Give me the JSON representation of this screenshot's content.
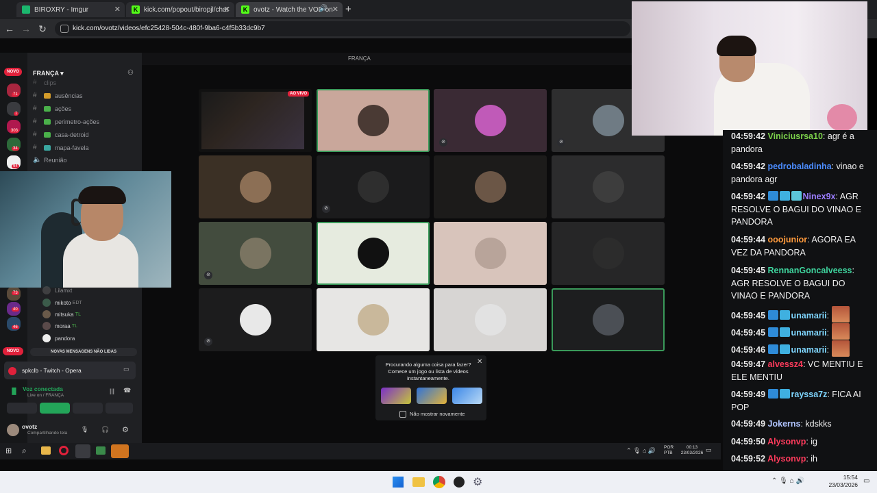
{
  "browser": {
    "tabs": [
      {
        "label": "BIROXRY - Imgur",
        "color": "#1bb76e"
      },
      {
        "label": "kick.com/popout/biropjl/chat",
        "color": "#53fc18"
      },
      {
        "label": "ovotz - Watch the VOD on",
        "color": "#53fc18"
      }
    ],
    "new_tab": "+",
    "url": "kick.com/ovotz/videos/efc25428-504c-480f-9ba6-c4f5b33dc9b7",
    "icons": [
      "back-icon",
      "forward-icon",
      "reload-icon",
      "site-info-icon",
      "close-icon",
      "speaker-icon",
      "plus-icon"
    ]
  },
  "discord": {
    "server_name": "FRANÇA",
    "top_title": "FRANÇA",
    "novo_badge": "NOVO",
    "novo_badge_bottom": "NOVO",
    "server_counts": [
      "71",
      "1",
      "303",
      "34",
      "94",
      "73",
      "40",
      "46"
    ],
    "channels": [
      "clips",
      "ausências",
      "ações",
      "perimetro-ações",
      "casa-detroid",
      "mapa-favela",
      "Reunião"
    ],
    "voice_members": [
      {
        "name": "Lilamxt",
        "tag": ""
      },
      {
        "name": "mikoto",
        "tag": "EDT"
      },
      {
        "name": "mitsuka",
        "tag": "TL"
      },
      {
        "name": "moraa",
        "tag": "TL"
      },
      {
        "name": "pandora",
        "tag": ""
      }
    ],
    "unread_banner": "NOVAS MENSAGENS NÃO LIDAS",
    "activity": "spkclb - Twitch - Opera",
    "voice_status": "Voz conectada",
    "voice_channel": "Live on / FRANÇA",
    "user_name": "ovotz",
    "user_status": "Compartilhando tela"
  },
  "grid": {
    "live_label": "AO VIVO",
    "tile_colors": [
      "#111111",
      "#c9a79b",
      "#3a2a34",
      "#2e2e2f",
      "#3b3025",
      "#1b1b1c",
      "#1c1b1a",
      "#2c2c2d",
      "#434c3e",
      "#e6ebdf",
      "#d8c4bb",
      "#262627",
      "#1c1c1d",
      "#e7e6e4",
      "#d7d5d3",
      "#1d1e1f"
    ],
    "avatar_colors": [
      "#333333",
      "#4a3a34",
      "#c05ab8",
      "#6f7b84",
      "#8c6f55",
      "#2e2e2e",
      "#6b5646",
      "#3d3d3d",
      "#7a7461",
      "#111111",
      "#b8a49a",
      "#2c2c2c",
      "#e8e8e8",
      "#c9b89b",
      "#e2e2e2",
      "#4b4f55"
    ],
    "active_tiles": [
      1,
      9,
      15
    ]
  },
  "popup": {
    "title": "Procurando alguma coisa para fazer? Comece um jogo ou lista de vídeos instantaneamente.",
    "checkbox_label": "Não mostrar novamente"
  },
  "inner_taskbar": {
    "lang": "POR",
    "lang2": "PTB",
    "time": "00:13",
    "date": "23/03/2026"
  },
  "chat": {
    "messages": [
      {
        "time": "04:59:42",
        "user": "Viniciusrsa10",
        "color": "#7cd14b",
        "badges": 0,
        "text": ": agr é a pandora"
      },
      {
        "time": "04:59:42",
        "user": "pedrobaladinha",
        "color": "#4b8cff",
        "badges": 0,
        "text": ": vinao e pandora agr"
      },
      {
        "time": "04:59:42",
        "user": "Ninex9x",
        "color": "#9b7dff",
        "badges": 3,
        "text": ": AGR RESOLVE O BAGUI DO VINAO E PANDORA"
      },
      {
        "time": "04:59:44",
        "user": "ooojunior",
        "color": "#ff9a3c",
        "badges": 0,
        "text": ": AGORA EA VEZ DA PANDORA"
      },
      {
        "time": "04:59:45",
        "user": "RennanGoncalveess",
        "color": "#3fd69f",
        "badges": 0,
        "text": ": AGR RESOLVE O BAGUI DO VINAO E PANDORA"
      },
      {
        "time": "04:59:45",
        "user": "unamarii",
        "color": "#7fd6ff",
        "badges": 2,
        "text": ":"
      },
      {
        "time": "04:59:45",
        "user": "unamarii",
        "color": "#7fd6ff",
        "badges": 2,
        "text": ":"
      },
      {
        "time": "04:59:46",
        "user": "unamarii",
        "color": "#7fd6ff",
        "badges": 2,
        "text": ":"
      },
      {
        "time": "04:59:47",
        "user": "alvessz4",
        "color": "#ff3b5c",
        "badges": 0,
        "text": ": VC MENTIU E ELE MENTIU"
      },
      {
        "time": "04:59:49",
        "user": "rayssa7z",
        "color": "#7fd6ff",
        "badges": 2,
        "text": ": FICA AI POP"
      },
      {
        "time": "04:59:49",
        "user": "Jokerns",
        "color": "#b0c4ff",
        "badges": 0,
        "text": ": kdskks"
      },
      {
        "time": "04:59:50",
        "user": "Alysonvp",
        "color": "#ff3b5c",
        "badges": 0,
        "text": ": ig"
      },
      {
        "time": "04:59:52",
        "user": "Alysonvp",
        "color": "#ff3b5c",
        "badges": 0,
        "text": ": ih"
      }
    ]
  },
  "os_taskbar": {
    "time": "15:54",
    "date": "23/03/2026"
  },
  "colors": {
    "kick_green": "#53fc18",
    "discord_green": "#23a559",
    "novo_red": "#e0213b"
  }
}
